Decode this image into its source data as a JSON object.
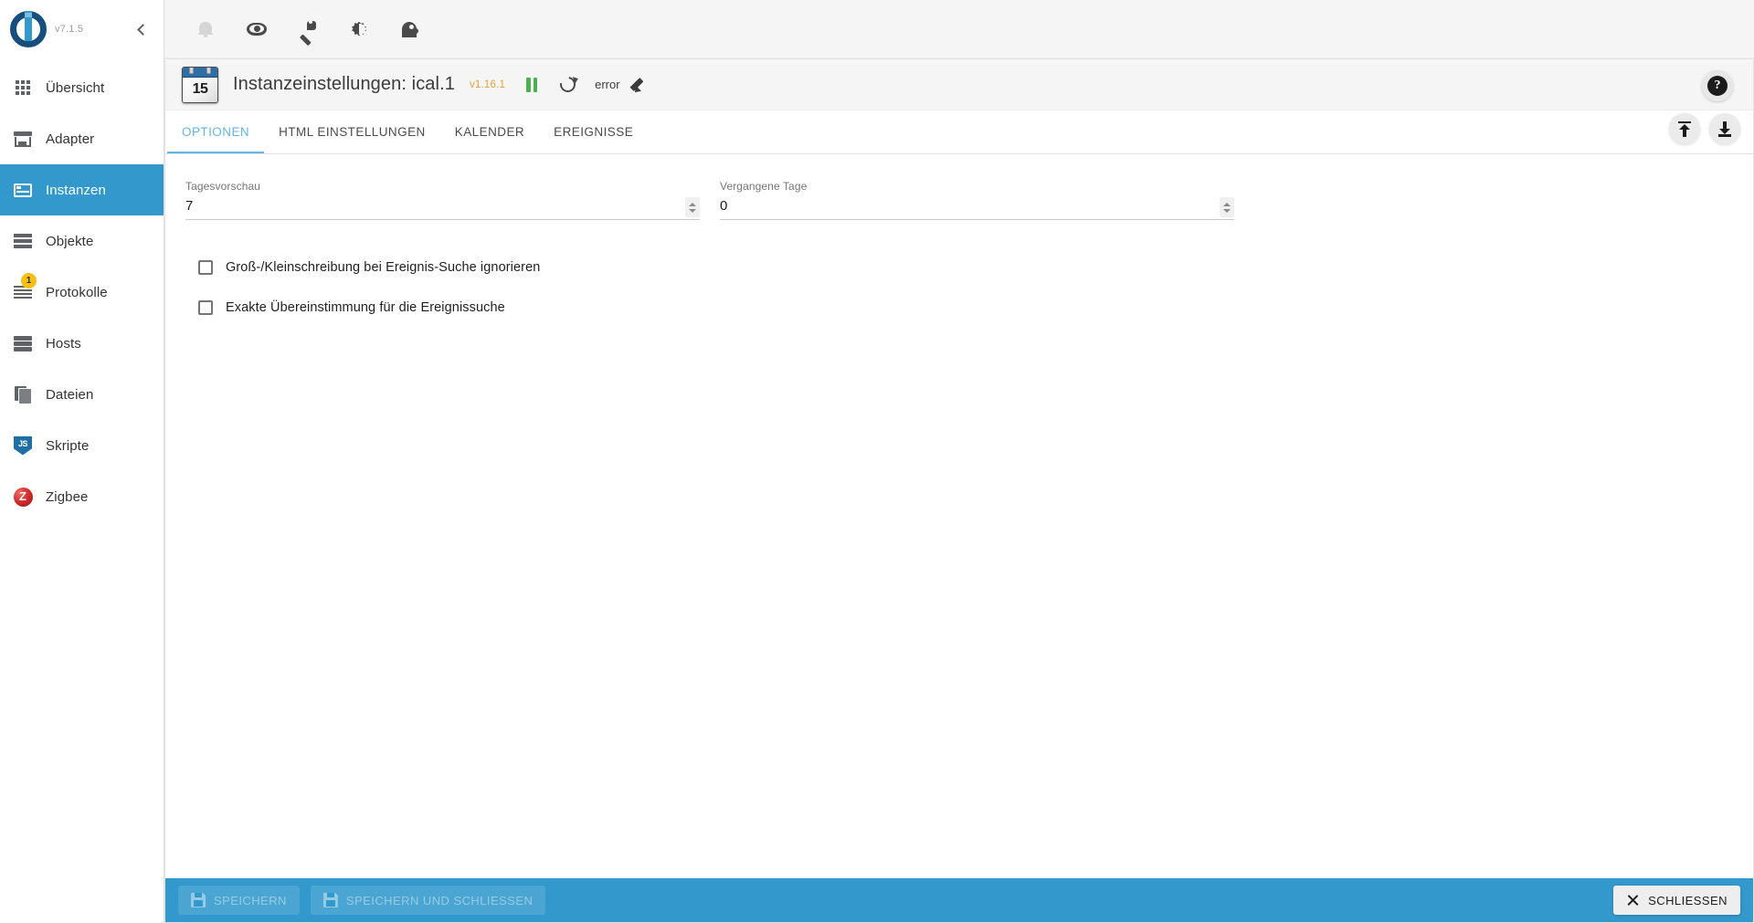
{
  "app": {
    "version": "v7.1.5",
    "logo_name": "iobroker-logo"
  },
  "sidebar": {
    "collapse_icon": "chevron-left-icon",
    "items": [
      {
        "label": "Übersicht",
        "icon": "grid-icon",
        "active": false,
        "badge": null
      },
      {
        "label": "Adapter",
        "icon": "store-icon",
        "active": false,
        "badge": null
      },
      {
        "label": "Instanzen",
        "icon": "instances-icon",
        "active": true,
        "badge": null
      },
      {
        "label": "Objekte",
        "icon": "list-icon",
        "active": false,
        "badge": null
      },
      {
        "label": "Protokolle",
        "icon": "logs-icon",
        "active": false,
        "badge": "1"
      },
      {
        "label": "Hosts",
        "icon": "server-icon",
        "active": false,
        "badge": null
      },
      {
        "label": "Dateien",
        "icon": "files-icon",
        "active": false,
        "badge": null
      },
      {
        "label": "Skripte",
        "icon": "javascript-icon",
        "active": false,
        "badge": null
      },
      {
        "label": "Zigbee",
        "icon": "zigbee-icon",
        "active": false,
        "badge": null
      }
    ]
  },
  "topbar": {
    "icons": [
      {
        "name": "notifications-bell-icon",
        "title": "Benachrichtigungen",
        "disabled": true
      },
      {
        "name": "expert-mode-eye-icon",
        "title": "Expertenmodus",
        "disabled": false
      },
      {
        "name": "settings-wrench-icon",
        "title": "Einstellungen",
        "disabled": false
      },
      {
        "name": "theme-brightness-icon",
        "title": "Theme",
        "disabled": false
      },
      {
        "name": "user-head-icon",
        "title": "Benutzer",
        "disabled": false
      }
    ]
  },
  "instance": {
    "icon": "calendar-icon",
    "icon_day": "15",
    "title": "Instanzeinstellungen: ical.1",
    "version": "v1.16.1",
    "status_text": "error",
    "pause_icon": "pause-icon",
    "restart_icon": "restart-icon",
    "edit_icon": "pencil-icon",
    "help_icon": "help-question-icon",
    "help_label": "?"
  },
  "tabs": [
    {
      "label": "Optionen",
      "active": true
    },
    {
      "label": "HTML Einstellungen",
      "active": false
    },
    {
      "label": "Kalender",
      "active": false
    },
    {
      "label": "Ereignisse",
      "active": false
    }
  ],
  "tab_actions": [
    {
      "name": "upload-config-icon",
      "label": "Upload"
    },
    {
      "name": "download-config-icon",
      "label": "Download"
    }
  ],
  "form": {
    "fields": [
      {
        "label": "Tagesvorschau",
        "value": "7",
        "spinner": true
      },
      {
        "label": "Vergangene Tage",
        "value": "0",
        "spinner": true
      }
    ],
    "checkboxes": [
      {
        "label": "Groß-/Kleinschreibung bei Ereignis-Suche ignorieren",
        "checked": false
      },
      {
        "label": "Exakte Übereinstimmung für die Ereignissuche",
        "checked": false
      }
    ]
  },
  "footer": {
    "save_label": "Speichern",
    "save_close_label": "Speichern und schließen",
    "close_label": "Schliessen",
    "save_icon": "floppy-disk-icon",
    "close_icon": "close-x-icon"
  },
  "colors": {
    "accent": "#3399cc",
    "tab_active": "#62b5e5",
    "version_text": "#e3a33a",
    "badge": "#f5c012",
    "pause_green": "#4caf50",
    "logo_dark": "#164f7e"
  }
}
